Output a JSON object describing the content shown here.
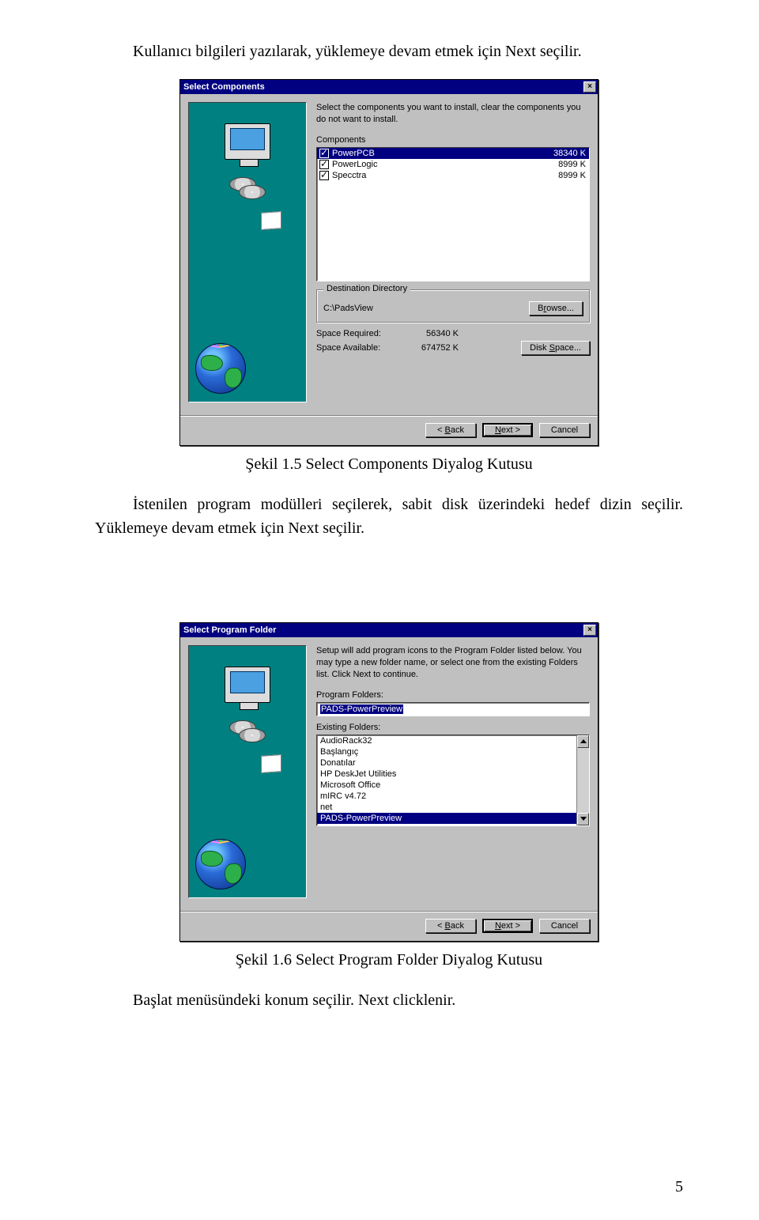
{
  "text": {
    "intro": "Kullanıcı bilgileri yazılarak, yüklemeye devam etmek için Next seçilir.",
    "caption1": "Şekil 1.5  Select Components Diyalog Kutusu",
    "middle": "İstenilen program modülleri seçilerek, sabit disk üzerindeki hedef dizin seçilir. Yüklemeye devam etmek için Next seçilir.",
    "caption2": "Şekil 1.6  Select Program Folder Diyalog Kutusu",
    "outro": "Başlat menüsündeki konum seçilir. Next clicklenir.",
    "page_num": "5"
  },
  "dialog1": {
    "title": "Select Components",
    "close": "×",
    "instr": "Select the components you want to install, clear the components you do not want to install.",
    "components_label": "Components",
    "components": [
      {
        "name": "PowerPCB",
        "size": "38340 K",
        "checked": true,
        "selected": true
      },
      {
        "name": "PowerLogic",
        "size": "8999 K",
        "checked": true,
        "selected": false
      },
      {
        "name": "Specctra",
        "size": "8999 K",
        "checked": true,
        "selected": false
      }
    ],
    "dest_group": "Destination Directory",
    "dest_path": "C:\\PadsView",
    "browse_btn": "Browse...",
    "space_req_label": "Space Required:",
    "space_req_val": "56340 K",
    "space_avail_label": "Space Available:",
    "space_avail_val": "674752 K",
    "disk_space_btn": "Disk Space...",
    "back_btn": "< Back",
    "next_btn": "Next >",
    "cancel_btn": "Cancel"
  },
  "dialog2": {
    "title": "Select Program Folder",
    "close": "×",
    "instr": "Setup will add program icons to the Program Folder listed below. You may type a new folder name, or select one from the existing Folders list.  Click Next to continue.",
    "prog_folders_label": "Program Folders:",
    "prog_folder_value": "PADS-PowerPreview",
    "existing_label": "Existing Folders:",
    "existing": [
      {
        "name": "AudioRack32",
        "selected": false
      },
      {
        "name": "Başlangıç",
        "selected": false
      },
      {
        "name": "Donatılar",
        "selected": false
      },
      {
        "name": "HP DeskJet Utilities",
        "selected": false
      },
      {
        "name": "Microsoft Office",
        "selected": false
      },
      {
        "name": "mIRC v4.72",
        "selected": false
      },
      {
        "name": "net",
        "selected": false
      },
      {
        "name": "PADS-PowerPreview",
        "selected": true
      }
    ],
    "back_btn": "< Back",
    "next_btn": "Next >",
    "cancel_btn": "Cancel"
  }
}
